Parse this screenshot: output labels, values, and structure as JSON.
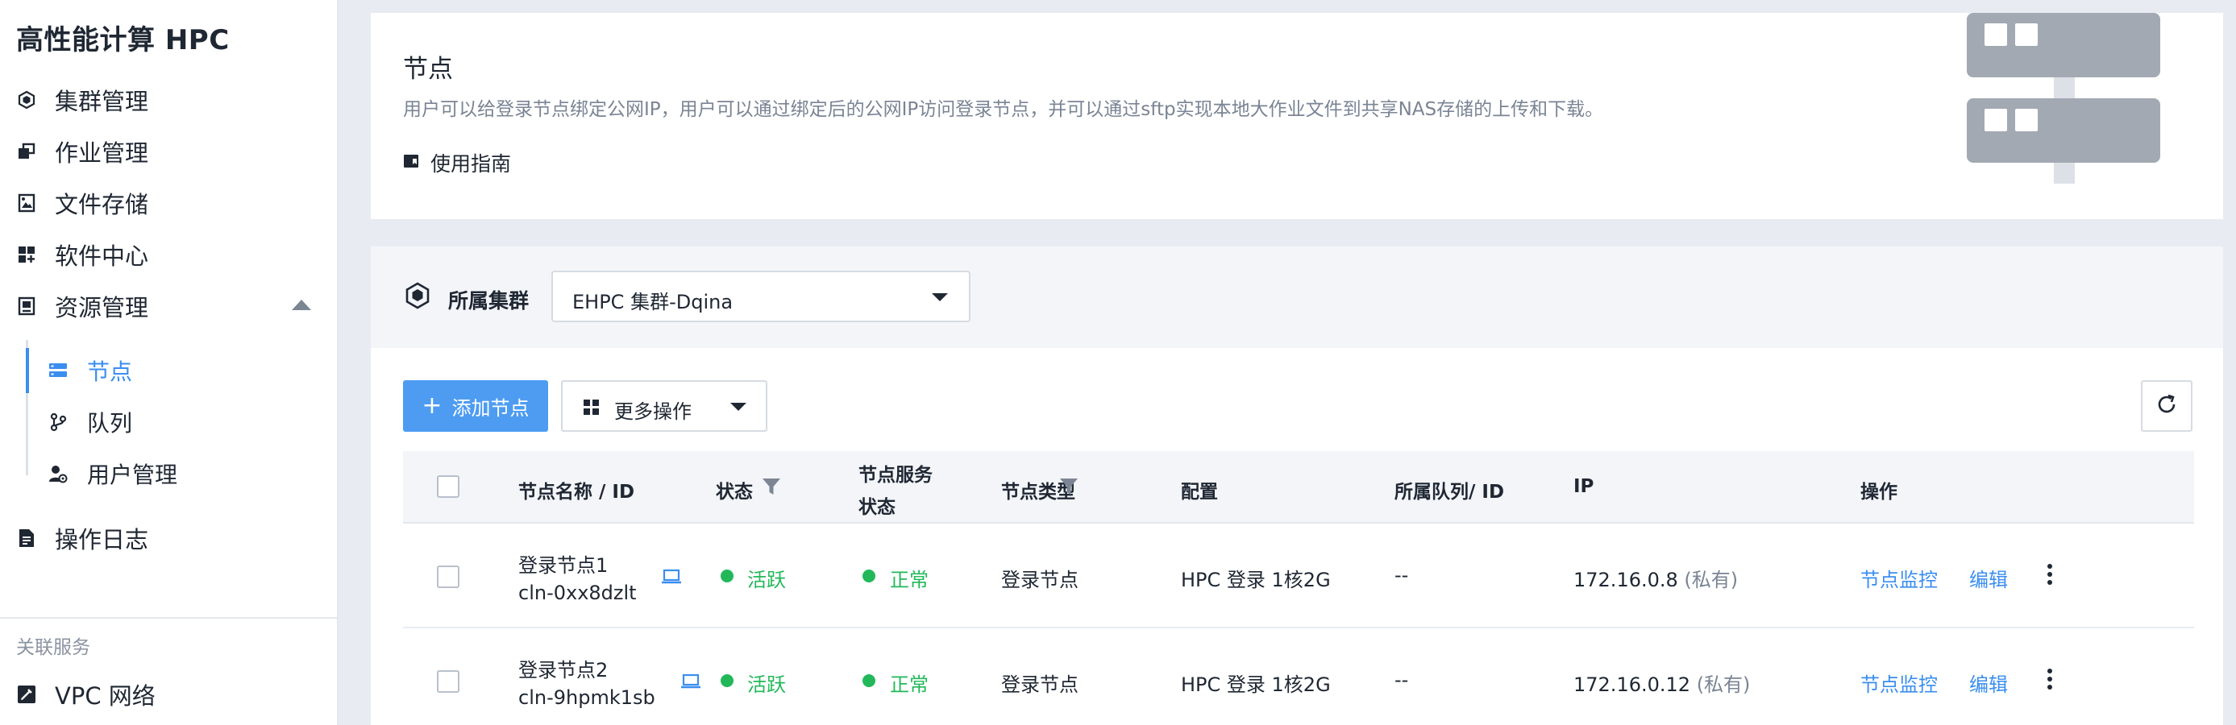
{
  "app": {
    "title": "高性能计算 HPC"
  },
  "sidebar": {
    "items": [
      {
        "label": "集群管理",
        "icon": "cluster-icon"
      },
      {
        "label": "作业管理",
        "icon": "jobs-icon"
      },
      {
        "label": "文件存储",
        "icon": "file-storage-icon"
      },
      {
        "label": "软件中心",
        "icon": "software-icon"
      },
      {
        "label": "资源管理",
        "icon": "resource-icon",
        "expanded": true
      }
    ],
    "sub_items": [
      {
        "label": "节点",
        "icon": "node-icon",
        "active": true
      },
      {
        "label": "队列",
        "icon": "queue-icon"
      },
      {
        "label": "用户管理",
        "icon": "user-icon"
      }
    ],
    "log": {
      "label": "操作日志",
      "icon": "log-icon"
    },
    "related_title": "关联服务",
    "vpc": {
      "label": "VPC 网络",
      "icon": "vpc-icon"
    }
  },
  "info": {
    "title": "节点",
    "description": "用户可以给登录节点绑定公网IP，用户可以通过绑定后的公网IP访问登录节点，并可以通过sftp实现本地大作业文件到共享NAS存储的上传和下载。",
    "guide_label": "使用指南"
  },
  "cluster": {
    "label": "所属集群",
    "selected": "EHPC 集群-Dqina"
  },
  "toolbar": {
    "add_label": "添加节点",
    "more_label": "更多操作"
  },
  "table": {
    "headers": {
      "name": "节点名称 / ID",
      "status": "状态",
      "service_status_1": "节点服务",
      "service_status_2": "状态",
      "type": "节点类型",
      "config": "配置",
      "queue": "所属队列/ ID",
      "ip": "IP",
      "actions": "操作"
    },
    "rows": [
      {
        "name": "登录节点1",
        "id": "cln-0xx8dzlt",
        "status": "活跃",
        "service_status": "正常",
        "type": "登录节点",
        "config": "HPC 登录 1核2G",
        "queue": "--",
        "ip": "172.16.0.8",
        "ip_note": "(私有)",
        "monitor": "节点监控",
        "edit": "编辑"
      },
      {
        "name": "登录节点2",
        "id": "cln-9hpmk1sb",
        "status": "活跃",
        "service_status": "正常",
        "type": "登录节点",
        "config": "HPC 登录 1核2G",
        "queue": "--",
        "ip": "172.16.0.12",
        "ip_note": "(私有)",
        "monitor": "节点监控",
        "edit": "编辑"
      }
    ]
  },
  "colors": {
    "accent": "#3a8ef0",
    "primary_button": "#4d9cf2",
    "success": "#22b85a"
  }
}
